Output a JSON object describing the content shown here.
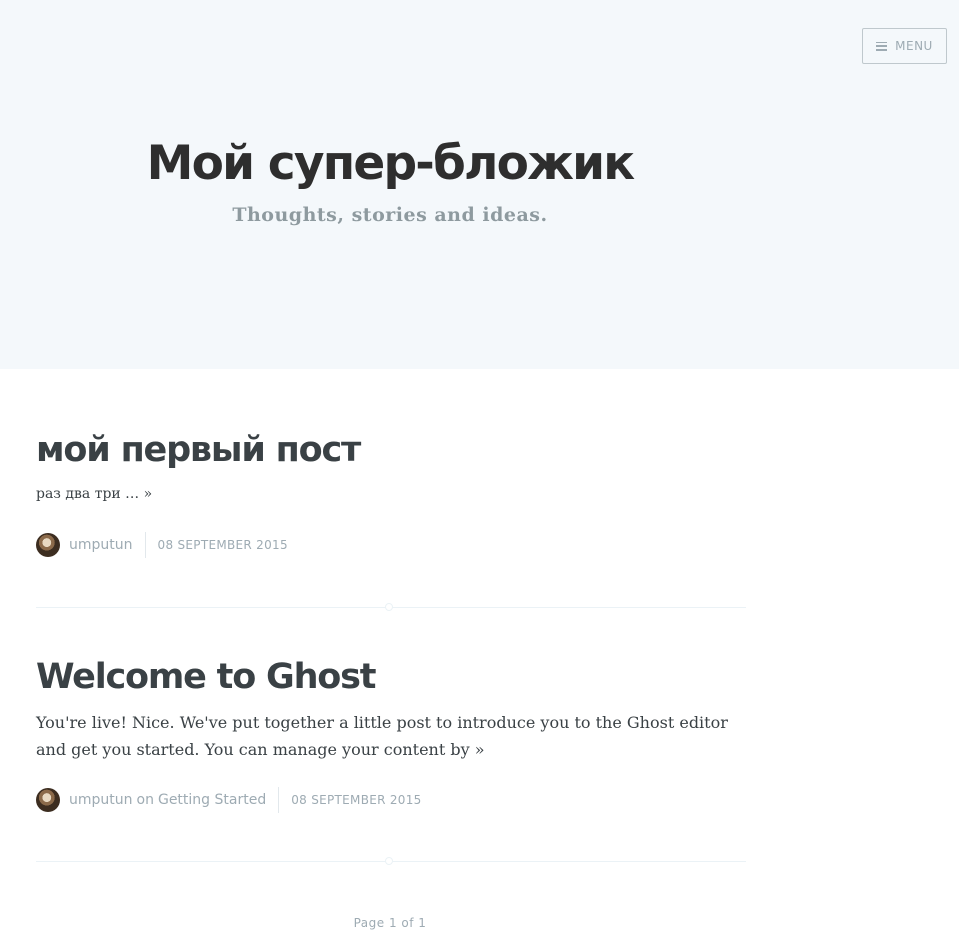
{
  "header": {
    "menu_label": "MENU",
    "blog_title": "Мой супер-бложик",
    "blog_description": "Thoughts, stories and ideas."
  },
  "posts": [
    {
      "title": "мой первый пост",
      "excerpt": "раз два три …",
      "read_more": "»",
      "author": "umputun",
      "date": "08 SEPTEMBER 2015"
    },
    {
      "title": "Welcome to Ghost",
      "excerpt": "You're live! Nice. We've put together a little post to introduce you to the Ghost editor and get you started. You can manage your content by",
      "read_more": "»",
      "author": "umputun",
      "on_word": "on",
      "tag": "Getting Started",
      "date": "08 SEPTEMBER 2015"
    }
  ],
  "pagination": {
    "text": "Page 1 of 1"
  },
  "colors": {
    "header_bg": "#f4f8fb",
    "text": "#3a4145",
    "meta": "#9eabb3"
  }
}
